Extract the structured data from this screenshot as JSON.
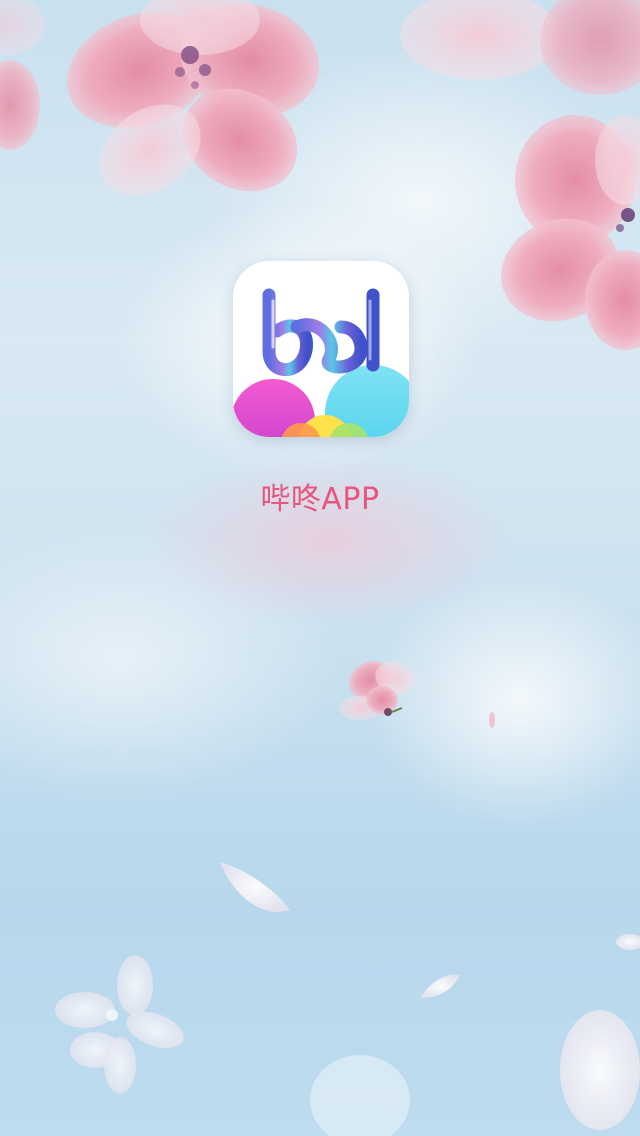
{
  "splash": {
    "app_name": "哔咚APP",
    "logo_icon": "bd-logo-icon",
    "brand_color": "#e8557f"
  }
}
